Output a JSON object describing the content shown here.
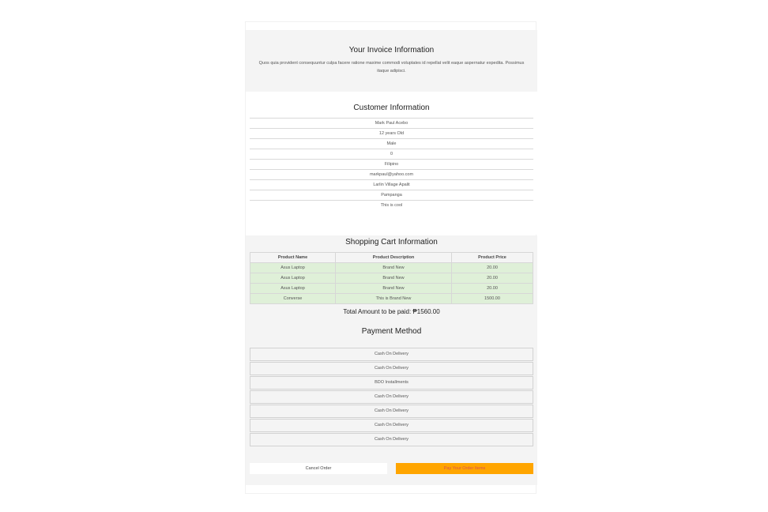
{
  "invoice": {
    "title": "Your Invoice Information",
    "description": "Quos quia provident consequuntur culpa facere ratione maxime commodi voluptates id repellat velit eaque aspernatur expedita. Possimus itaque adipisci."
  },
  "customer": {
    "title": "Customer Information",
    "fields": [
      "Mark Paul Acebo",
      "12 years Old",
      "Male",
      "0",
      "Filipino",
      "markpaul@yahoo.com",
      "Larlin Village Apalit",
      "Pampanga",
      "This is cool"
    ]
  },
  "cart": {
    "title": "Shopping Cart Information",
    "headers": [
      "Product Name",
      "Product Description",
      "Product Price"
    ],
    "rows": [
      [
        "Asus Laptop",
        "Brand New",
        "20.00"
      ],
      [
        "Asus Laptop",
        "Brand New",
        "20.00"
      ],
      [
        "Asus Laptop",
        "Brand New",
        "20.00"
      ],
      [
        "Converse",
        "This is Brand New",
        "1500.00"
      ]
    ],
    "total_label": "Total Amount to be paid: ₱1560.00"
  },
  "payment": {
    "title": "Payment Method",
    "options": [
      "Cash On Delivery",
      "Cash On Delivery",
      "BDO Installments",
      "Cash On Delivery",
      "Cash On Delivery",
      "Cash On Delivery",
      "Cash On Delivery"
    ]
  },
  "actions": {
    "cancel_label": "Cancel Order",
    "pay_label": "Pay Your Order Items"
  },
  "colors": {
    "accent": "#ffa500",
    "pay_text": "#d9534f",
    "row_highlight": "#dff0d8",
    "section_bg": "#f4f4f4"
  }
}
